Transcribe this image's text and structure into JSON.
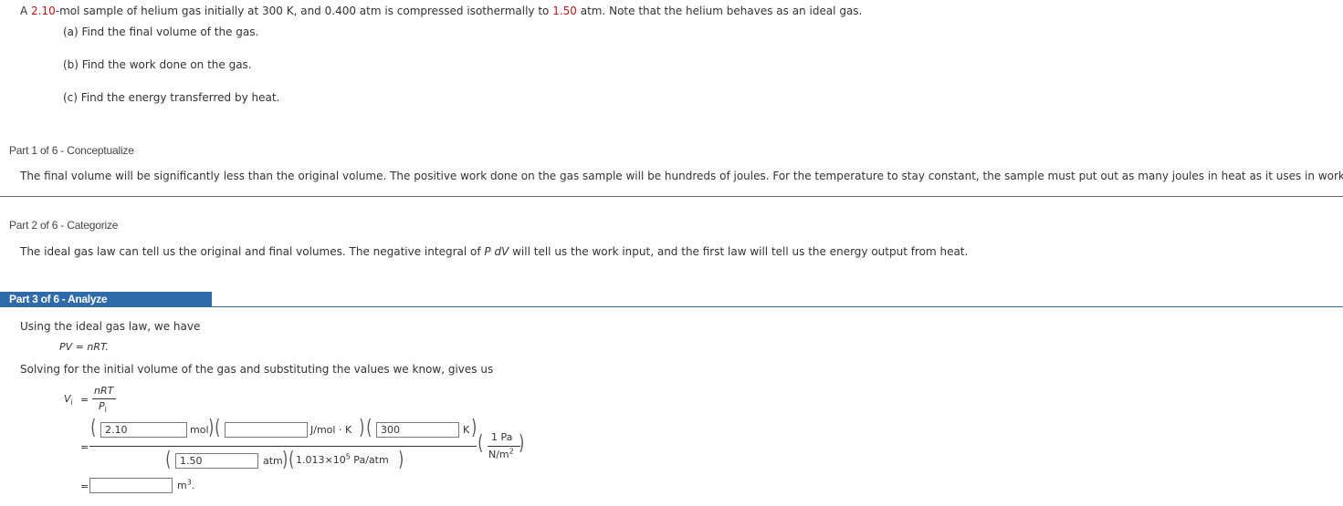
{
  "problem": {
    "intro_pre": "A ",
    "moles": "2.10",
    "intro_mid": "-mol sample of helium gas initially at 300 K, and 0.400 atm is compressed isothermally to ",
    "final_pressure": "1.50",
    "intro_post": " atm. Note that the helium behaves as an ideal gas.",
    "questions": [
      "(a) Find the final volume of the gas.",
      "(b) Find the work done on the gas.",
      "(c) Find the energy transferred by heat."
    ]
  },
  "parts": [
    {
      "heading": "Part 1 of 6 - Conceptualize",
      "text": "The final volume will be significantly less than the original volume. The positive work done on the gas sample will be hundreds of joules. For the temperature to stay constant, the sample must put out as many joules in heat as it uses in work."
    },
    {
      "heading": "Part 2 of 6 - Categorize",
      "text_pre": "The ideal gas law can tell us the original and final volumes. The negative integral of ",
      "text_math": "P dV",
      "text_post": " will tell us the work input, and the first law will tell us the energy output from heat."
    },
    {
      "heading": "Part 3 of 6 - Analyze",
      "line1": "Using the ideal gas law, we have",
      "equation": "PV = nRT.",
      "line2": "Solving for the initial volume of the gas and substituting the values we know, gives us",
      "formula": {
        "lhs": "V",
        "lhs_sub": "i",
        "equals": "=",
        "num": "nRT",
        "den": "P",
        "den_sub": "i"
      },
      "substitution": {
        "n_value": "2.10",
        "n_unit": "mol",
        "r_value": "",
        "r_unit": "J/mol · K",
        "t_value": "300",
        "t_unit": "K",
        "p_value": "1.50",
        "p_unit": "atm",
        "conv_pre": "1.013×10",
        "conv_exp": "5",
        "conv_post": " Pa/atm",
        "pa_num": "1 Pa",
        "pa_den": "N/m",
        "pa_den_exp": "2"
      },
      "result": {
        "value": "",
        "unit": "m",
        "unit_exp": "3",
        "suffix": "."
      }
    }
  ],
  "colors": {
    "given_value": "#c0151c",
    "active_part": "#2f6aaa"
  }
}
